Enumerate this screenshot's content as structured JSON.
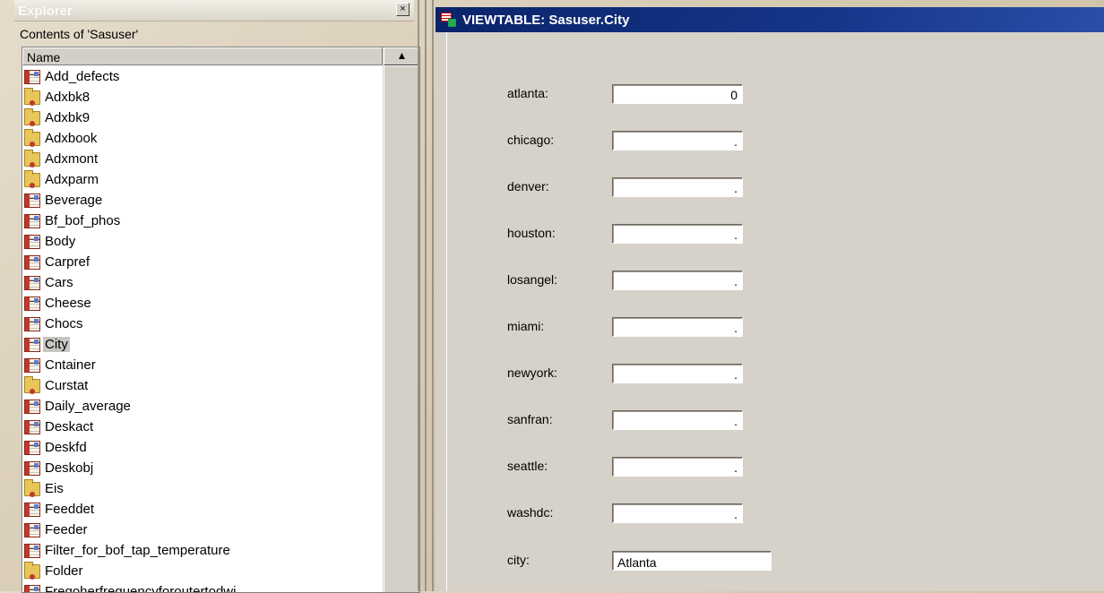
{
  "explorer": {
    "title": "Explorer",
    "close_glyph": "×",
    "contents_label": "Contents of 'Sasuser'",
    "column_header": "Name",
    "scroll_up_glyph": "▲",
    "items": [
      {
        "label": "Add_defects",
        "icon": "table-icon"
      },
      {
        "label": "Adxbk8",
        "icon": "folder-icon"
      },
      {
        "label": "Adxbk9",
        "icon": "folder-icon"
      },
      {
        "label": "Adxbook",
        "icon": "folder-icon"
      },
      {
        "label": "Adxmont",
        "icon": "folder-icon"
      },
      {
        "label": "Adxparm",
        "icon": "folder-icon"
      },
      {
        "label": "Beverage",
        "icon": "table-icon"
      },
      {
        "label": "Bf_bof_phos",
        "icon": "table-icon"
      },
      {
        "label": "Body",
        "icon": "table-icon"
      },
      {
        "label": "Carpref",
        "icon": "table-icon"
      },
      {
        "label": "Cars",
        "icon": "table-icon"
      },
      {
        "label": "Cheese",
        "icon": "table-icon"
      },
      {
        "label": "Chocs",
        "icon": "table-icon"
      },
      {
        "label": "City",
        "icon": "table-icon",
        "selected": true
      },
      {
        "label": "Cntainer",
        "icon": "table-icon"
      },
      {
        "label": "Curstat",
        "icon": "folder-icon"
      },
      {
        "label": "Daily_average",
        "icon": "table-icon"
      },
      {
        "label": "Deskact",
        "icon": "table-icon"
      },
      {
        "label": "Deskfd",
        "icon": "table-icon"
      },
      {
        "label": "Deskobj",
        "icon": "table-icon"
      },
      {
        "label": "Eis",
        "icon": "folder-icon"
      },
      {
        "label": "Feeddet",
        "icon": "table-icon"
      },
      {
        "label": "Feeder",
        "icon": "table-icon"
      },
      {
        "label": "Filter_for_bof_tap_temperature",
        "icon": "table-icon"
      },
      {
        "label": "Folder",
        "icon": "folder-icon"
      },
      {
        "label": "Freqoherfrequencyforoutertodwi",
        "icon": "table-icon"
      }
    ]
  },
  "viewtable": {
    "title": "VIEWTABLE: Sasuser.City",
    "fields": [
      {
        "label": "atlanta:",
        "value": "0"
      },
      {
        "label": "chicago:",
        "value": "."
      },
      {
        "label": "denver:",
        "value": "."
      },
      {
        "label": "houston:",
        "value": "."
      },
      {
        "label": "losangel:",
        "value": "."
      },
      {
        "label": "miami:",
        "value": "."
      },
      {
        "label": "newyork:",
        "value": "."
      },
      {
        "label": "sanfran:",
        "value": "."
      },
      {
        "label": "seattle:",
        "value": "."
      },
      {
        "label": "washdc:",
        "value": "."
      },
      {
        "label": "city:",
        "value": "Atlanta"
      }
    ]
  }
}
